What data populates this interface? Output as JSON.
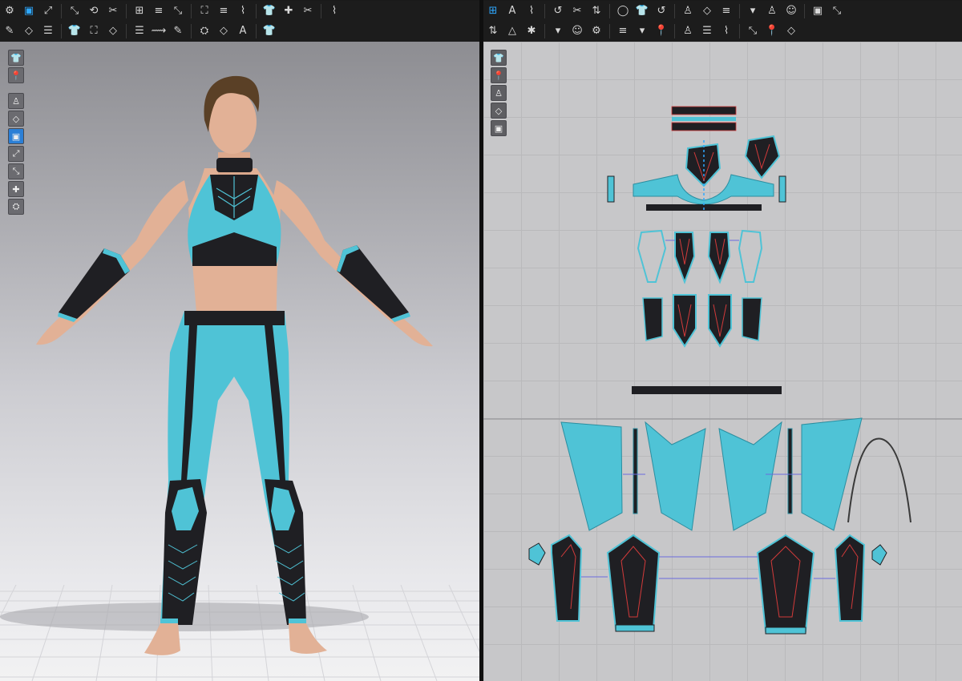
{
  "toolbar_3d_row1": [
    "pointer-menu-icon",
    "select-move-icon",
    "transform-icon",
    "garment-icon",
    "fold-icon",
    "arrange-icon",
    "rotate-icon",
    "tack-icon",
    "pin-icon",
    "brush-icon",
    "avatar-measure-icon",
    "hanger-icon",
    "fitting-icon",
    "body-icon",
    "avatar-icon",
    "animation-icon"
  ],
  "toolbar_3d_row2": [
    "walk-icon",
    "sewing-icon",
    "needle-icon",
    "scissors-icon",
    "edit-seam-icon",
    "topstitch-icon",
    "puckering-icon",
    "button-icon",
    "buttonhole-icon",
    "zipper-icon",
    "strap-icon",
    "tape-icon",
    "elastic-icon"
  ],
  "toolbar_2d_row1": [
    "transform-pattern-icon",
    "edit-pattern-icon",
    "polygon-icon",
    "rectangle-icon",
    "internal-shape-icon",
    "circle-icon",
    "dart-icon",
    "segment-sew-icon",
    "notch-icon",
    "texture-icon",
    "ruler-icon",
    "grading-icon",
    "text-icon",
    "annotation-icon",
    "grid-icon",
    "fabric-icon",
    "avatar-2d-icon"
  ],
  "toolbar_2d_row2": [
    "edit-curve-icon",
    "add-point-icon",
    "curve-point-icon",
    "trace-icon",
    "fold-arrange-icon",
    "shirt-2d-icon",
    "pattern-sew-icon",
    "free-sew-icon",
    "check-sew-icon",
    "measure-icon",
    "tape-measure-icon",
    "length-icon",
    "zigzag-icon",
    "layer-icon",
    "settings-icon"
  ],
  "viewport_tools": [
    "garment-cube-icon",
    "shirt-view-icon",
    "fabric-view-icon",
    "brush-view-icon",
    "avatar-view-icon",
    "texture-view-icon",
    "shade-view-icon",
    "skin-view-icon",
    "globe-view-icon"
  ],
  "pattern_tools": [
    "pen-icon",
    "shirt-icon",
    "info-icon",
    "cube-icon",
    "disabled-icon"
  ],
  "colors": {
    "fabric_teal": "#4fc3d6",
    "fabric_black": "#1f1f23",
    "accent_blue": "#2ea8ff",
    "seam_red": "#d23a3a",
    "skin": "#e2b196",
    "hair": "#5a4026"
  }
}
